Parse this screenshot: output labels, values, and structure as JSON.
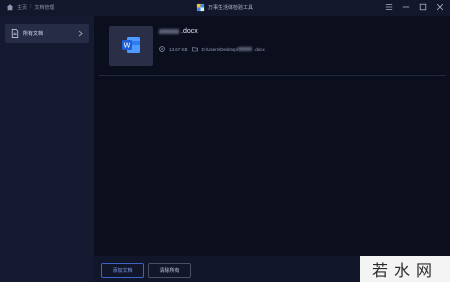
{
  "titlebar": {
    "home_label": "主页",
    "separator": "/",
    "section_label": "文档管理",
    "app_title": "万事生活体检验工具"
  },
  "sidebar": {
    "items": [
      {
        "label": "所有文档"
      }
    ]
  },
  "file": {
    "name_suffix": ".docx",
    "size": "13.67 KB",
    "path_prefix": "D:\\Users\\Desktop\\",
    "path_suffix": ".docx"
  },
  "footer": {
    "add_label": "添加文档",
    "clear_label": "清除所有"
  },
  "watermark": {
    "text": "若水网"
  },
  "colors": {
    "accent": "#3d63c6",
    "word_blue": "#2f7bf0"
  }
}
